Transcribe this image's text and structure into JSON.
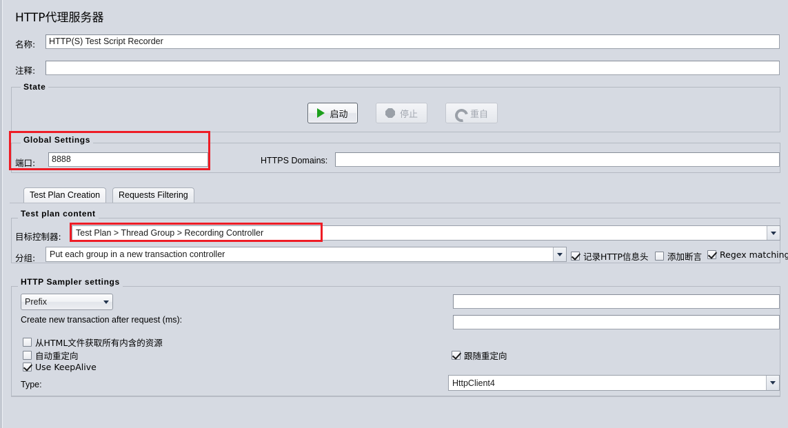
{
  "window": {
    "title": "HTTP代理服务器"
  },
  "fields": {
    "name_label": "名称:",
    "name_value": "HTTP(S) Test Script Recorder",
    "comment_label": "注释:",
    "comment_value": ""
  },
  "state": {
    "title": "State",
    "start_button": "启动",
    "stop_button": "停止",
    "restart_button": "重自",
    "start_icon": "play-triangle-icon",
    "stop_icon": "stop-octagon-icon",
    "restart_icon": "restart-arrow-icon"
  },
  "global_settings": {
    "title": "Global Settings",
    "port_label": "端口:",
    "port_value": "8888",
    "https_domains_label": "HTTPS Domains:",
    "https_domains_value": ""
  },
  "tabs": [
    {
      "label": "Test Plan Creation",
      "active": true
    },
    {
      "label": "Requests Filtering",
      "active": false
    }
  ],
  "test_plan_content": {
    "title": "Test plan content",
    "target_controller_label": "目标控制器:",
    "target_controller_value": "Test Plan > Thread Group > Recording Controller",
    "grouping_label": "分组:",
    "grouping_value": "Put each group in a new transaction controller",
    "checkboxes": [
      {
        "label": "记录HTTP信息头",
        "checked": true
      },
      {
        "label": "添加断言",
        "checked": false
      },
      {
        "label": "Regex matching",
        "checked": true
      }
    ]
  },
  "http_sampler_settings": {
    "title": "HTTP Sampler settings",
    "prefix_value": "Prefix",
    "prefix_field_value": "",
    "transaction_label": "Create new transaction after request (ms):",
    "transaction_value": "",
    "checkboxes_left": [
      {
        "label": "从HTML文件获取所有内含的资源",
        "checked": false
      },
      {
        "label": "自动重定向",
        "checked": false
      },
      {
        "label": "Use KeepAlive",
        "checked": true
      }
    ],
    "checkbox_right": {
      "label": "跟随重定向",
      "checked": true
    },
    "type_label": "Type:",
    "type_value": "HttpClient4"
  },
  "annotations": {
    "highlight_color": "#ee1c25",
    "boxes": [
      {
        "name": "global-settings-highlight"
      },
      {
        "name": "target-controller-highlight"
      }
    ]
  }
}
